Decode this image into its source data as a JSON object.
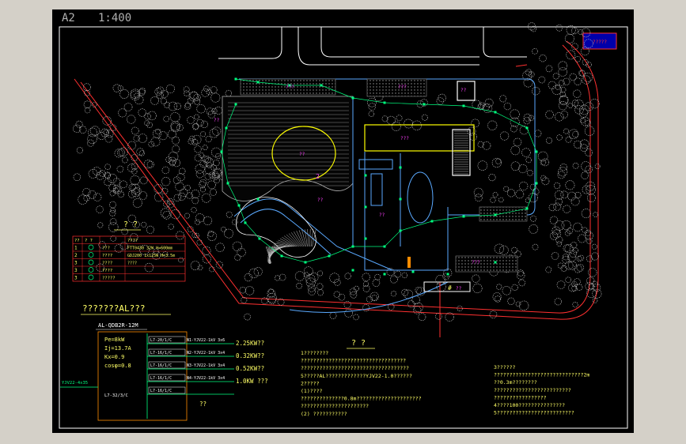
{
  "sheet": {
    "size_label": "A2",
    "scale_label": "1:400"
  },
  "title_stamp": {
    "text": "?????"
  },
  "site_labels": {
    "lake": "??",
    "bridge": "??",
    "office": "???",
    "parking": "???",
    "waterfall": "??",
    "lawn": "???",
    "rest_area": "???",
    "pavilion": "??",
    "guard": "??",
    "entrance_mark": "#",
    "entrance_sub": "??",
    "circle_num": "2"
  },
  "legend": {
    "title": "? ?",
    "headers": [
      "??",
      "? ?",
      "????"
    ],
    "rows": [
      {
        "no": "1",
        "symbol": "spot-lamp-icon",
        "name": "???",
        "spec": "FTT0430 32W H=600mm"
      },
      {
        "no": "2",
        "symbol": "garden-lamp-icon",
        "name": "????",
        "spec": "GDJ200 1x125W H=3.5m"
      },
      {
        "no": "3",
        "symbol": "ground-lamp-icon",
        "name": "????",
        "spec": "????"
      },
      {
        "no": "3",
        "symbol": "wall-lamp-icon",
        "name": "????",
        "spec": ""
      },
      {
        "no": "3",
        "symbol": "distribution-box-icon",
        "name": "?????",
        "spec": ""
      }
    ]
  },
  "panel": {
    "title": "???????AL???",
    "box_code": "AL-QDB2R-12M",
    "params": [
      "Pe=8kW",
      "Ij=13.7A",
      "Kx=0.9",
      "cosφ=0.8"
    ],
    "incoming_cable": "YJV22-4x35",
    "main_breaker": "L7-32/3/C",
    "circuits": [
      {
        "breaker": "L7-20/1/C",
        "cable": "N1-YJV22-1kV 3x6",
        "load": "2.25KW??"
      },
      {
        "breaker": "L7-16/1/C",
        "cable": "N2-YJV22-1kV 3x4",
        "load": "0.32KW??"
      },
      {
        "breaker": "L7-16/1/C",
        "cable": "N3-YJV22-1kV 3x4",
        "load": "0.52KW??"
      },
      {
        "breaker": "L7-16/1/C",
        "cable": "N4-YJV22-1kV 3x4",
        "load": "1.0KW ???"
      },
      {
        "breaker": "L7-16/1/C",
        "cable": "",
        "load": "??"
      }
    ]
  },
  "notes": {
    "title": "? ?",
    "left": [
      "1????????",
      "  ??????????????????????????????????",
      "  ???????????????????????????????????",
      "  5?????AL?????????????YJV22-1.0??????",
      "2?????",
      "  (1)????",
      "  ??????????????0.8m?????????????????????",
      "  ??????????????????????",
      "  (2) ???????????"
    ],
    "right": [
      "3??????",
      "  ?????????????????????????????2m",
      "  ??0.3m????????",
      "  ?????????????????????????",
      "  ?????????????????",
      "4????100???????????????",
      "5?????????????????????????"
    ]
  },
  "colors": {
    "paper": "#000000",
    "frame": "#ffffff",
    "tree": "#bfbfbf",
    "road": "#ff3030",
    "lamp": "#00ff7f",
    "wire": "#5aa9ff",
    "building": "#ffff00",
    "label": "#ff40ff",
    "text": "#ffff66",
    "water": "#b0b0b0"
  }
}
